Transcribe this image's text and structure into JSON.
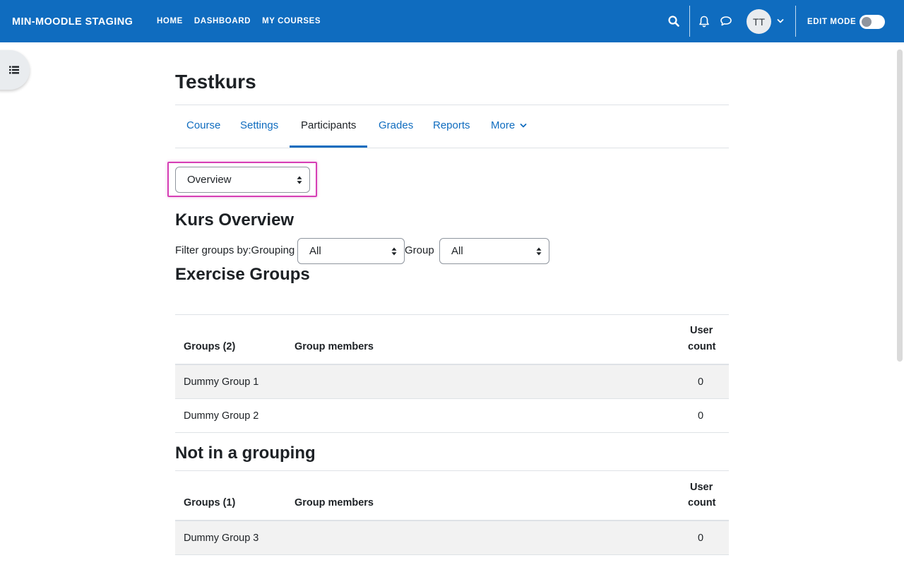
{
  "navbar": {
    "brand": "MIN-MOODLE STAGING",
    "links": [
      "HOME",
      "DASHBOARD",
      "MY COURSES"
    ],
    "avatar_initials": "TT",
    "edit_mode_label": "EDIT MODE",
    "edit_mode_on": false,
    "bg_color": "#0f6cbf"
  },
  "icons": {
    "search": "search-icon",
    "notifications": "bell-icon",
    "messages": "chat-icon",
    "user_menu": "chevron-down-icon",
    "drawer": "list-icon"
  },
  "course": {
    "title": "Testkurs"
  },
  "tabs": [
    {
      "label": "Course",
      "active": false
    },
    {
      "label": "Settings",
      "active": false
    },
    {
      "label": "Participants",
      "active": true
    },
    {
      "label": "Grades",
      "active": false
    },
    {
      "label": "Reports",
      "active": false
    },
    {
      "label": "More",
      "active": false
    }
  ],
  "view_select": {
    "value": "Overview"
  },
  "overview": {
    "heading": "Kurs Overview",
    "filter_label": "Filter groups by:Grouping",
    "grouping_value": "All",
    "group_label": "Group",
    "group_value": "All"
  },
  "sections": [
    {
      "heading": "Exercise Groups",
      "columns": [
        "Groups (2)",
        "Group members",
        "User",
        "count"
      ],
      "rows": [
        {
          "group": "Dummy Group 1",
          "members": "",
          "count": "0"
        },
        {
          "group": "Dummy Group 2",
          "members": "",
          "count": "0"
        }
      ]
    },
    {
      "heading": "Not in a grouping",
      "columns": [
        "Groups (1)",
        "Group members",
        "User",
        "count"
      ],
      "rows": [
        {
          "group": "Dummy Group 3",
          "members": "",
          "count": "0"
        }
      ]
    }
  ]
}
